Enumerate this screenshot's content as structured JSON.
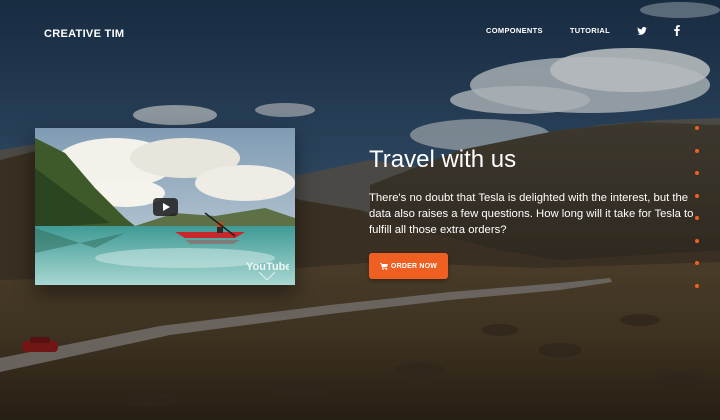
{
  "brand": {
    "name": "CREATIVE TIM"
  },
  "nav": {
    "items": [
      {
        "label": "COMPONENTS"
      },
      {
        "label": "TUTORIAL"
      }
    ],
    "social": [
      "twitter-icon",
      "facebook-icon"
    ]
  },
  "video": {
    "provider_logo": "YouTube",
    "play_icon": "play-icon"
  },
  "hero": {
    "title": "Travel with us",
    "description": "There's no doubt that Tesla is delighted with the interest, but the data also raises a few questions. How long will it take for Tesla to fulfill all those extra orders?",
    "cta_label": "ORDER NOW",
    "cta_icon": "cart-icon"
  },
  "slider": {
    "dot_count": 8
  },
  "colors": {
    "accent": "#f05f22",
    "text": "#ffffff"
  }
}
